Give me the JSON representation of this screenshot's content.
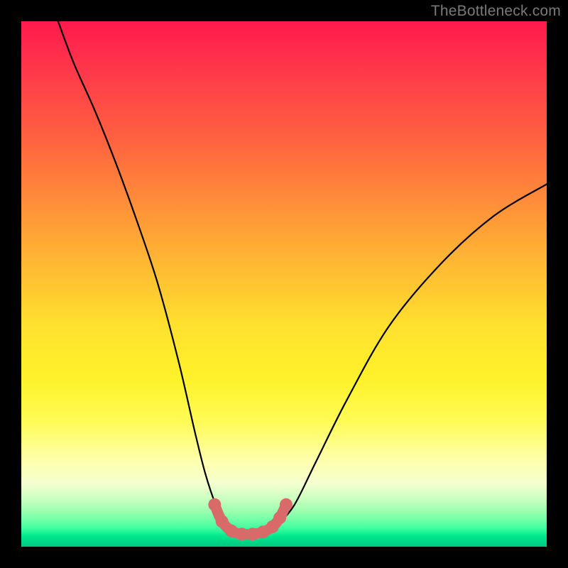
{
  "watermark": "TheBottleneck.com",
  "colors": {
    "background": "#000000",
    "curve": "#000000",
    "marker_fill": "#d96a6a",
    "marker_stroke": "#b84f4f"
  },
  "chart_data": {
    "type": "line",
    "title": "",
    "xlabel": "",
    "ylabel": "",
    "xlim": [
      0,
      100
    ],
    "ylim": [
      0,
      100
    ],
    "grid": false,
    "legend": false,
    "series": [
      {
        "name": "bottleneck-curve",
        "x": [
          7,
          10,
          14,
          18,
          22,
          26,
          30,
          33,
          35,
          37,
          39,
          41,
          43,
          45,
          47,
          49,
          52,
          56,
          62,
          70,
          80,
          90,
          100
        ],
        "y": [
          100,
          92,
          83,
          73,
          62,
          50,
          35,
          22,
          14,
          8,
          4,
          2.5,
          2.2,
          2.4,
          3,
          4.5,
          8,
          16,
          28,
          42,
          54,
          63,
          69
        ]
      }
    ],
    "markers": [
      {
        "x": 36.8,
        "y": 8.0
      },
      {
        "x": 38.2,
        "y": 4.8
      },
      {
        "x": 40.0,
        "y": 3.0
      },
      {
        "x": 42.0,
        "y": 2.4
      },
      {
        "x": 44.0,
        "y": 2.4
      },
      {
        "x": 46.0,
        "y": 2.8
      },
      {
        "x": 47.8,
        "y": 3.8
      },
      {
        "x": 49.2,
        "y": 5.5
      },
      {
        "x": 50.4,
        "y": 8.0
      }
    ]
  }
}
